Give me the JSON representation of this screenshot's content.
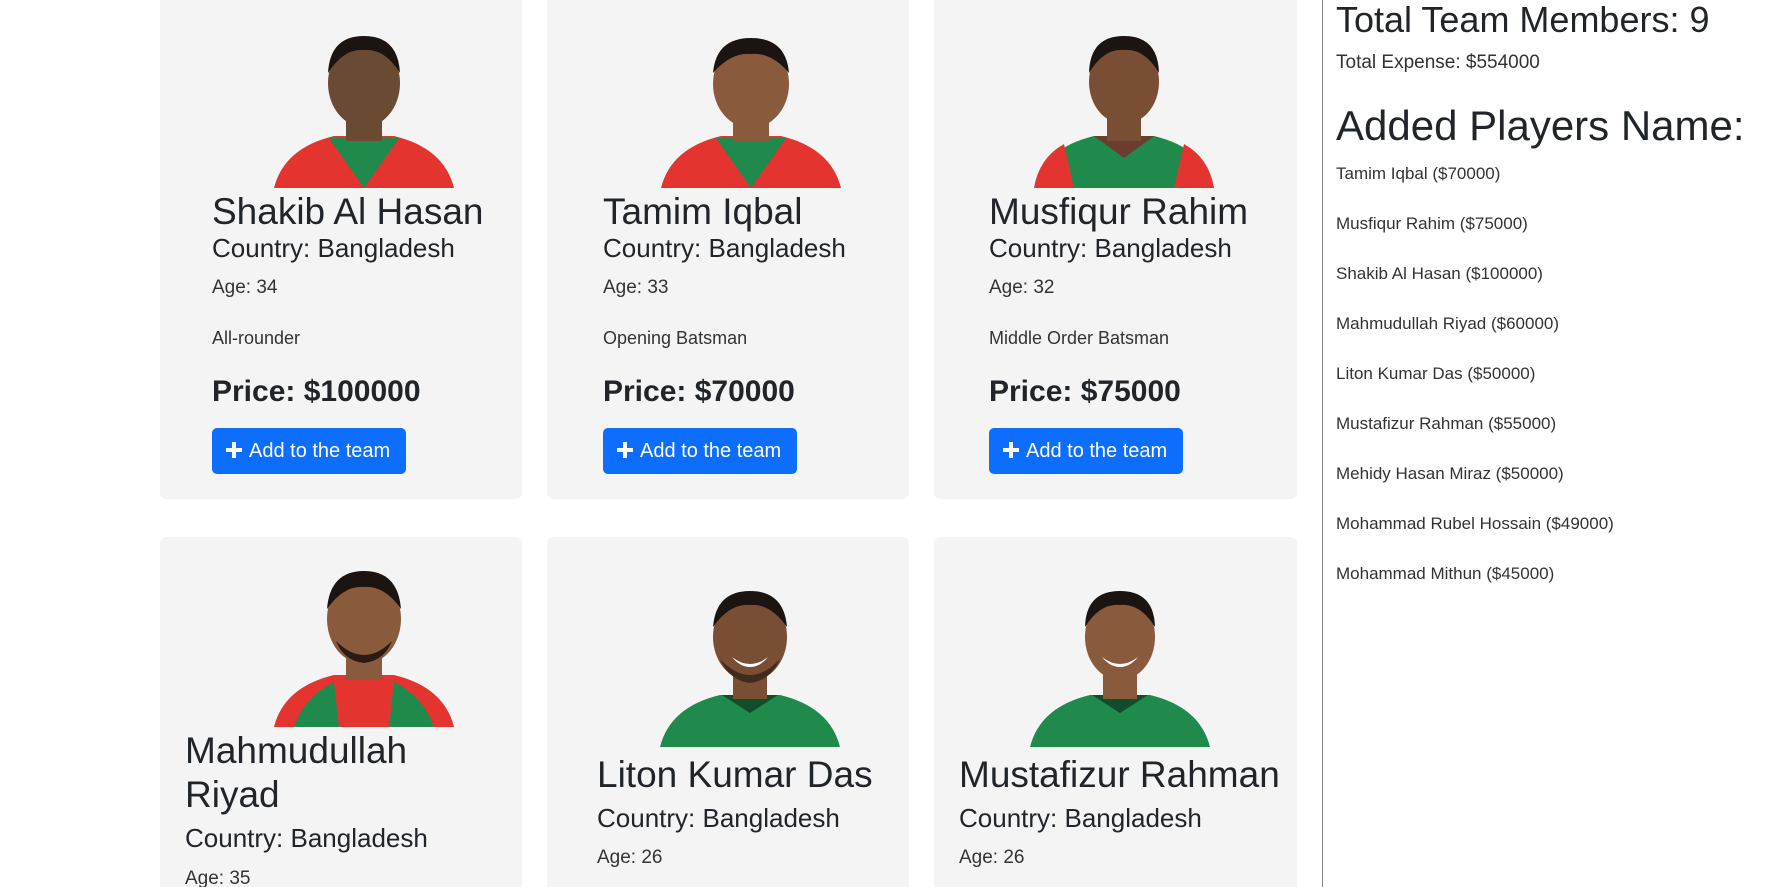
{
  "cards": [
    {
      "name": "Shakib Al Hasan",
      "country": "Country: Bangladesh",
      "age": "Age: 34",
      "role": "All-rounder",
      "price": "Price: $100000",
      "button": "Add to the team"
    },
    {
      "name": "Tamim Iqbal",
      "country": "Country: Bangladesh",
      "age": "Age: 33",
      "role": "Opening Batsman",
      "price": "Price: $70000",
      "button": "Add to the team"
    },
    {
      "name": "Musfiqur Rahim",
      "country": "Country: Bangladesh",
      "age": "Age: 32",
      "role": "Middle Order Batsman",
      "price": "Price: $75000",
      "button": "Add to the team"
    },
    {
      "name_line1": "Mahmudullah",
      "name_line2": "Riyad",
      "country": "Country: Bangladesh",
      "age": "Age: 35"
    },
    {
      "name": "Liton Kumar Das",
      "country": "Country: Bangladesh",
      "age": "Age: 26"
    },
    {
      "name": "Mustafizur Rahman",
      "country": "Country: Bangladesh",
      "age": "Age: 26"
    }
  ],
  "sidebar": {
    "total_members": "Total Team Members: 9",
    "total_expense": "Total Expense: $554000",
    "added_heading": "Added Players Name:",
    "players": [
      "Tamim Iqbal ($70000)",
      "Musfiqur Rahim ($75000)",
      "Shakib Al Hasan ($100000)",
      "Mahmudullah Riyad ($60000)",
      "Liton Kumar Das ($50000)",
      "Mustafizur Rahman ($55000)",
      "Mehidy Hasan Miraz ($50000)",
      "Mohammad Rubel Hossain ($49000)",
      "Mohammad Mithun ($45000)"
    ]
  },
  "colors": {
    "card_bg": "#f4f4f4",
    "button_blue": "#0d6efd",
    "jersey_green": "#1f8a4c",
    "jersey_red": "#e3342f"
  }
}
